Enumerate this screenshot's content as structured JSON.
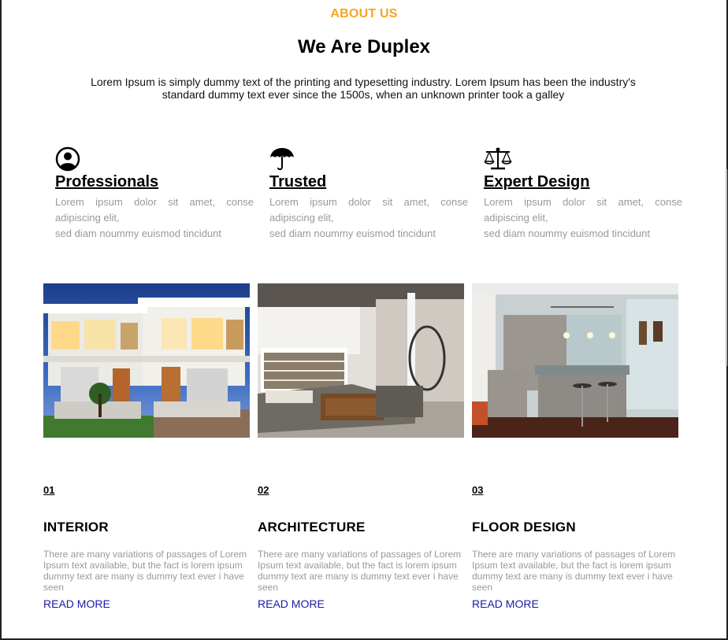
{
  "section": {
    "label": "ABOUT US",
    "title": "We Are Duplex",
    "intro": "Lorem Ipsum is simply dummy text of the printing and typesetting industry. Lorem Ipsum has been the industry's standard dummy text ever since the 1500s, when an unknown printer took a galley"
  },
  "features": [
    {
      "icon": "user-icon",
      "title": "Professionals",
      "line1": "Lorem ipsum dolor sit amet, conse",
      "line2": "adipiscing elit,",
      "line3": "sed diam noummy euismod tincidunt"
    },
    {
      "icon": "umbrella-icon",
      "title": "Trusted",
      "line1": "Lorem ipsum dolor sit amet, conse",
      "line2": "adipiscing elit,",
      "line3": "sed diam noummy euismod tincidunt"
    },
    {
      "icon": "scales-icon",
      "title": "Expert Design",
      "line1": "Lorem ipsum dolor sit amet, conse",
      "line2": "adipiscing elit,",
      "line3": "sed diam noummy euismod tincidunt"
    }
  ],
  "photos": [
    {
      "subject": "modern-duplex-house-exterior-dusk"
    },
    {
      "subject": "living-room-with-spiral-staircase"
    },
    {
      "subject": "modern-kitchen-with-bar-stools"
    }
  ],
  "services": [
    {
      "number": "01",
      "title": "INTERIOR",
      "description": "There are many variations of passages of Lorem Ipsum text available, but the fact is lorem ipsum dummy text are many is dummy text ever i have seen",
      "link": "READ MORE"
    },
    {
      "number": "02",
      "title": "ARCHITECTURE",
      "description": "There are many variations of passages of Lorem Ipsum text available, but the fact is lorem ipsum dummy text are many is dummy text ever i have seen",
      "link": "READ MORE"
    },
    {
      "number": "03",
      "title": "FLOOR DESIGN",
      "description": "There are many variations of passages of Lorem Ipsum text available, but the fact is lorem ipsum dummy text are many is dummy text ever i have seen",
      "link": "READ MORE"
    }
  ],
  "colors": {
    "accent": "#f5a623",
    "link": "#1a1aa6",
    "muted": "#999999"
  }
}
